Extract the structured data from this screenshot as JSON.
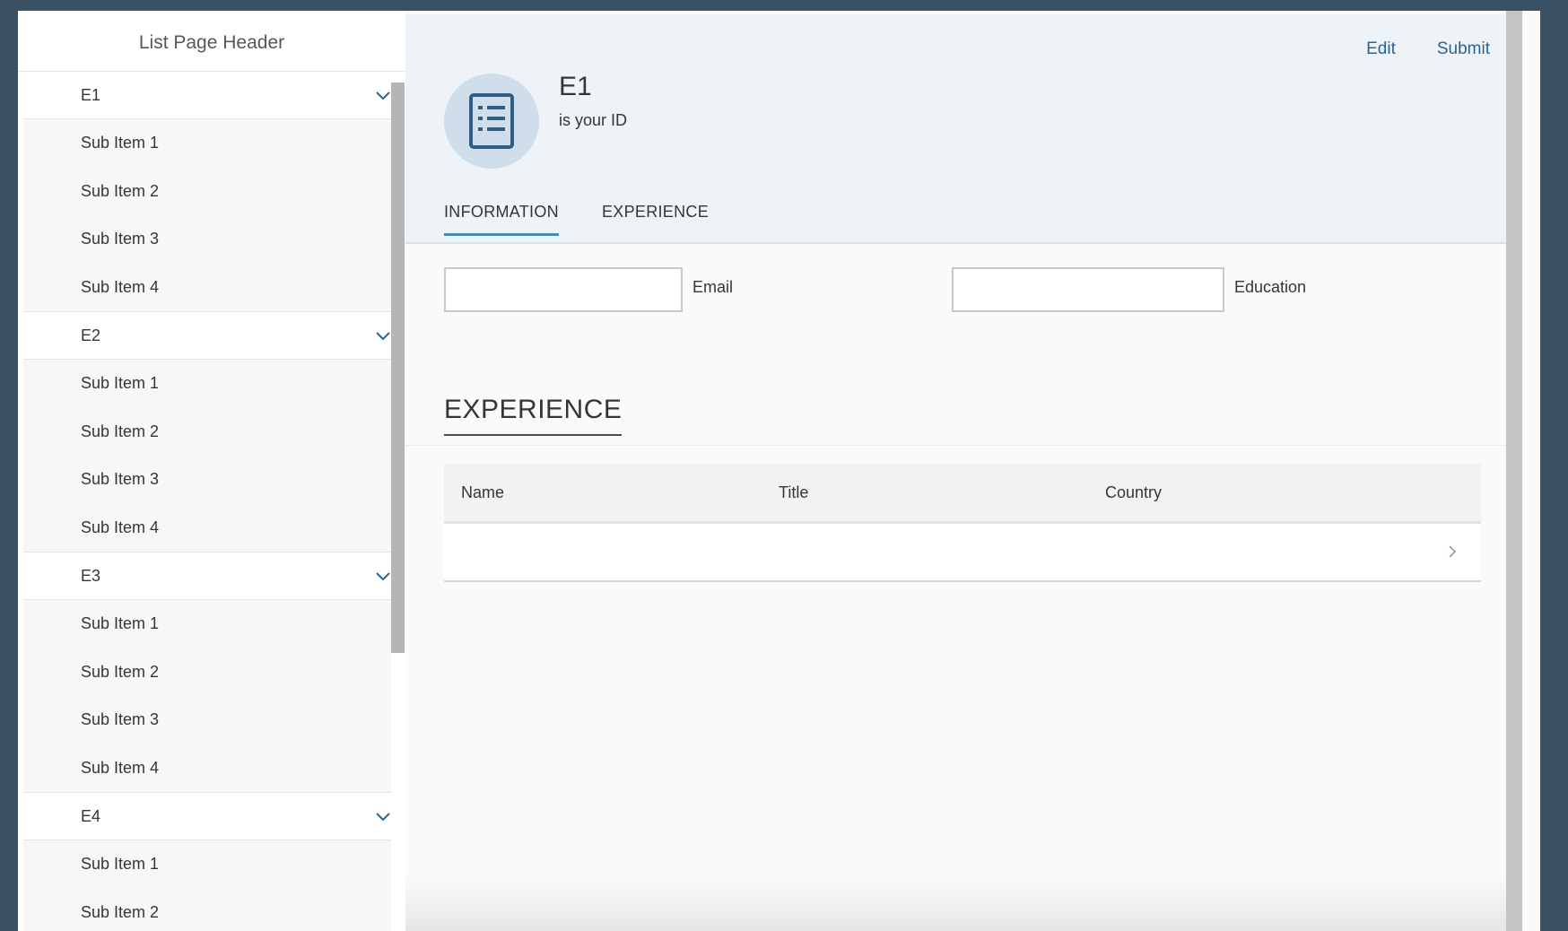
{
  "sidebar": {
    "header": "List Page Header",
    "groups": [
      {
        "label": "E1",
        "items": [
          "Sub Item 1",
          "Sub Item 2",
          "Sub Item 3",
          "Sub Item 4"
        ]
      },
      {
        "label": "E2",
        "items": [
          "Sub Item 1",
          "Sub Item 2",
          "Sub Item 3",
          "Sub Item 4"
        ]
      },
      {
        "label": "E3",
        "items": [
          "Sub Item 1",
          "Sub Item 2",
          "Sub Item 3",
          "Sub Item 4"
        ]
      },
      {
        "label": "E4",
        "items": [
          "Sub Item 1",
          "Sub Item 2"
        ]
      }
    ]
  },
  "header": {
    "actions": {
      "edit": "Edit",
      "submit": "Submit"
    },
    "title": "E1",
    "subtitle": "is your ID",
    "avatar_icon": "document-list-icon",
    "tabs": [
      {
        "label": "INFORMATION",
        "active": true
      },
      {
        "label": "EXPERIENCE",
        "active": false
      }
    ]
  },
  "form": {
    "email": {
      "label": "Email",
      "value": ""
    },
    "education": {
      "label": "Education",
      "value": ""
    }
  },
  "section": {
    "title": "EXPERIENCE"
  },
  "table": {
    "columns": [
      "Name",
      "Title",
      "Country"
    ],
    "rows": [
      {
        "name": "",
        "title": "",
        "country": ""
      }
    ]
  },
  "colors": {
    "accent": "#2b6393",
    "header_bg": "#eef3f7",
    "avatar_bg": "#cfdeea",
    "tab_underline": "#4b8ab8"
  }
}
